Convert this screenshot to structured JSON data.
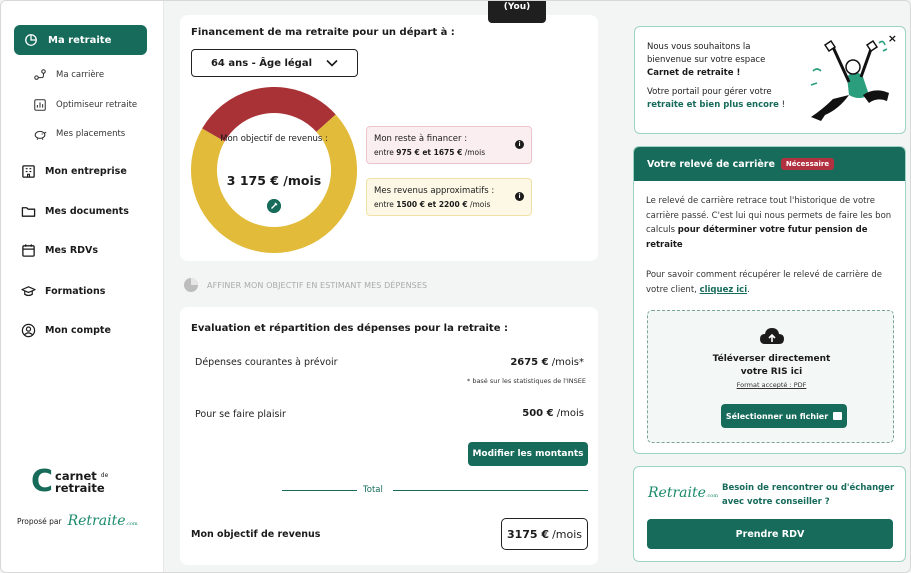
{
  "badge": "(You)",
  "sidebar": {
    "active_item": "Ma retraite",
    "sub_items": [
      {
        "label": "Ma carrière"
      },
      {
        "label": "Optimiseur retraite"
      },
      {
        "label": "Mes placements"
      }
    ],
    "items": [
      {
        "label": "Mon entreprise"
      },
      {
        "label": "Mes documents"
      },
      {
        "label": "Mes RDVs"
      },
      {
        "label": "Formations"
      },
      {
        "label": "Mon compte"
      }
    ],
    "brand": {
      "line1": "carnet",
      "de": "de",
      "line2": "retraite"
    },
    "proposed_by": "Proposé par",
    "partner_logo": "Retraite",
    "partner_logo_suffix": ".com"
  },
  "financing": {
    "title": "Financement de ma retraite pour un départ à :",
    "selected_option": "64 ans - Âge légal",
    "donut": {
      "label": "Mon objectif de revenus :",
      "value": "3 175 € /mois",
      "segments": [
        {
          "name": "reste",
          "fraction": 0.3,
          "color": "#a83236"
        },
        {
          "name": "revenus",
          "fraction": 0.7,
          "color": "#e2bb3a"
        }
      ]
    },
    "reste": {
      "title": "Mon reste à financer :",
      "prefix": "entre",
      "range": "975 € et 1675 €",
      "unit": "/mois"
    },
    "revenus": {
      "title": "Mes revenus approximatifs :",
      "prefix": "entre",
      "range": "1500 € et 2200 €",
      "unit": "/mois"
    }
  },
  "affiner": "AFFINER MON OBJECTIF EN ESTIMANT MES DÉPENSES",
  "expenses": {
    "title": "Evaluation et répartition des dépenses pour la retraite :",
    "row1": {
      "label": "Dépenses courantes à prévoir",
      "value": "2675 €",
      "unit": "/mois*"
    },
    "footnote": "* basé sur les statistiques de l'INSEE",
    "row2": {
      "label": "Pour se faire plaisir",
      "value": "500 €",
      "unit": "/mois"
    },
    "modify_button": "Modifier les montants",
    "total_label": "Total",
    "objectif_label": "Mon objectif de revenus",
    "objectif_value": "3175 €",
    "objectif_unit": "/mois"
  },
  "welcome": {
    "line1": "Nous vous souhaitons la bienvenue sur votre espace",
    "line2": "Carnet de retraite !",
    "line3": "Votre portail pour gérer votre",
    "line4": "retraite et bien plus encore",
    "line4_end": " !",
    "close": "×"
  },
  "releve": {
    "title": "Votre relevé de carrière",
    "tag": "Nécessaire",
    "p1_a": "Le relevé de carrière retrace tout l'historique de votre carrière passé. C'est lui qui nous permets de faire les bon calculs ",
    "p1_b": "pour déterminer votre futur pension de retraite",
    "p2_a": "Pour savoir comment récupérer le relevé de carrière de votre client, ",
    "p2_link": "cliquez ici",
    "p2_end": ".",
    "upload_title_1": "Téléverser directement",
    "upload_title_2": "votre RIS ici",
    "format": "Format accepté : PDF",
    "file_button": "Sélectionner un fichier"
  },
  "rdv": {
    "logo": "Retraite",
    "logo_suffix": ".com",
    "text": "Besoin de rencontrer ou d'échanger avec votre conseiller ?",
    "button": "Prendre RDV"
  }
}
